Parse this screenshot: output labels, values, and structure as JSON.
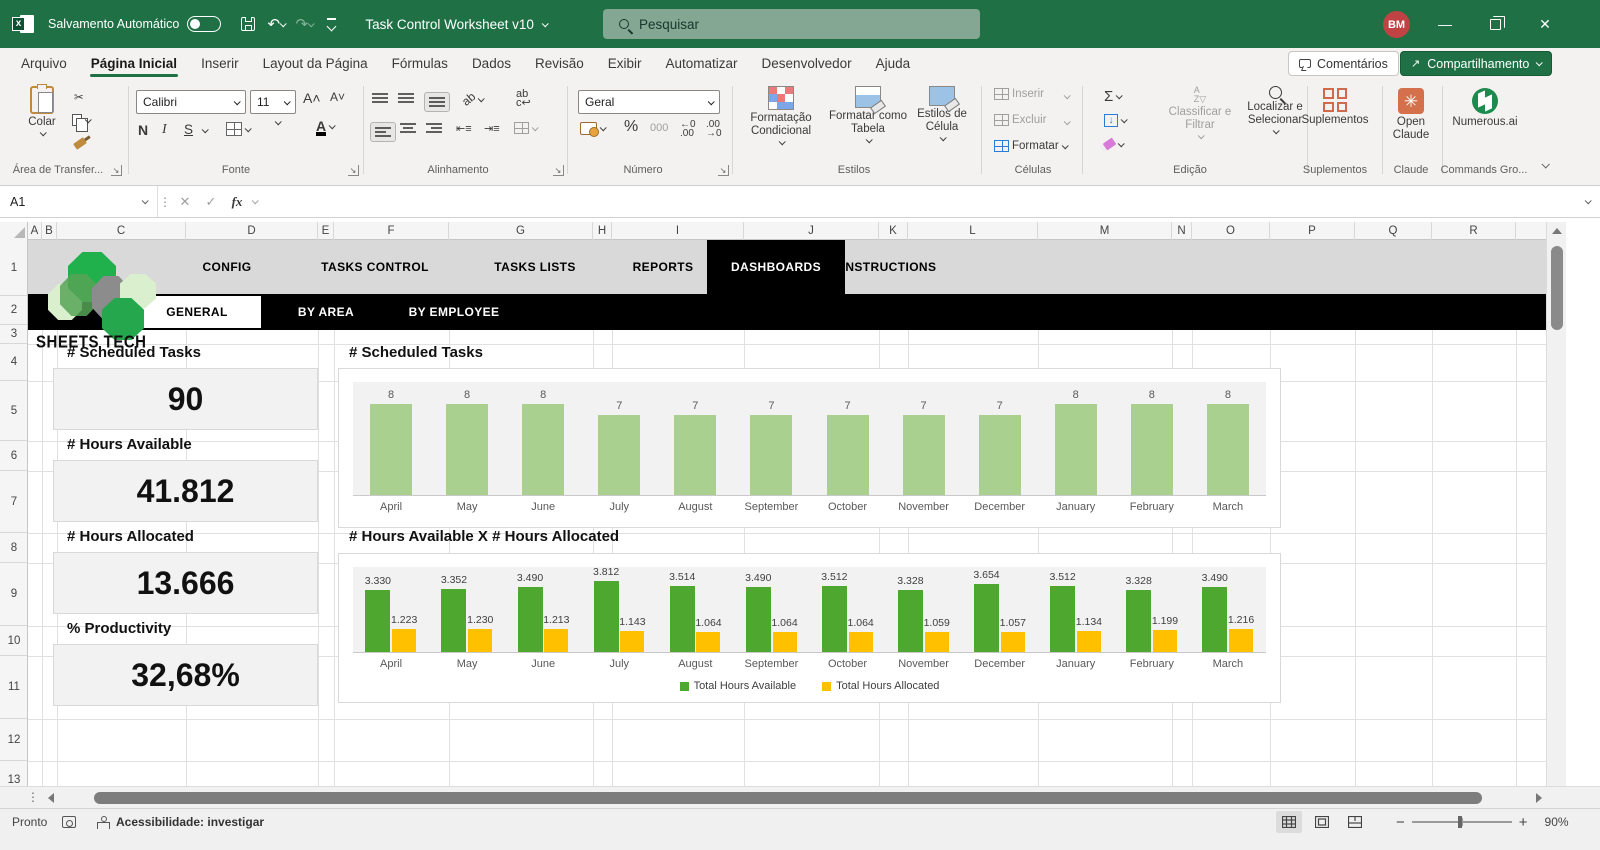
{
  "titlebar": {
    "autosave_label": "Salvamento Automático",
    "autosave_on": false,
    "doc_title": "Task Control Worksheet v10",
    "search_placeholder": "Pesquisar",
    "avatar_initials": "BM"
  },
  "menubar": {
    "tabs": [
      "Arquivo",
      "Página Inicial",
      "Inserir",
      "Layout da Página",
      "Fórmulas",
      "Dados",
      "Revisão",
      "Exibir",
      "Automatizar",
      "Desenvolvedor",
      "Ajuda"
    ],
    "active_tab": "Página Inicial",
    "comments_label": "Comentários",
    "share_label": "Compartilhamento"
  },
  "ribbon": {
    "paste_label": "Colar",
    "clipboard_group": "Área de Transfer...",
    "font_name": "Calibri",
    "font_size": "11",
    "bold": "N",
    "italic": "I",
    "underline": "S",
    "font_group": "Fonte",
    "alignment_group": "Alinhamento",
    "number_format": "Geral",
    "percent": "%",
    "thousands": "000",
    "number_group": "Número",
    "conditional_label": "Formatação Condicional",
    "table_label": "Formatar como Tabela",
    "cellstyles_label": "Estilos de Célula",
    "styles_group": "Estilos",
    "insert_label": "Inserir",
    "delete_label": "Excluir",
    "format_label": "Formatar",
    "cells_group": "Células",
    "sort_label": "Classificar e Filtrar",
    "find_label": "Localizar e Selecionar",
    "editing_group": "Edição",
    "addins_label": "Suplementos",
    "addins_group": "Suplementos",
    "claude_label": "Open Claude",
    "claude_group": "Claude",
    "numerous_label": "Numerous.ai",
    "numerous_group": "Commands Gro..."
  },
  "formula_bar": {
    "name_box": "A1",
    "fx": "fx"
  },
  "grid": {
    "columns": [
      "A",
      "B",
      "C",
      "D",
      "E",
      "F",
      "G",
      "H",
      "I",
      "J",
      "K",
      "L",
      "M",
      "N",
      "O",
      "P",
      "Q",
      "R"
    ],
    "rows": [
      "1",
      "2",
      "3",
      "4",
      "5",
      "6",
      "7",
      "8",
      "9",
      "10",
      "11",
      "12",
      "13"
    ]
  },
  "sheet": {
    "nav_tabs": [
      "CONFIG",
      "TASKS CONTROL",
      "TASKS LISTS",
      "REPORTS",
      "DASHBOARDS",
      "INSTRUCTIONS"
    ],
    "active_nav_tab": "DASHBOARDS",
    "sub_tabs": [
      "GENERAL",
      "BY AREA",
      "BY EMPLOYEE"
    ],
    "active_sub_tab": "GENERAL",
    "logo_text": "SHEETS TECH",
    "kpis": [
      {
        "label": "# Scheduled Tasks",
        "value": "90"
      },
      {
        "label": "# Hours Available",
        "value": "41.812"
      },
      {
        "label": "# Hours Allocated",
        "value": "13.666"
      },
      {
        "label": "% Productivity",
        "value": "32,68%"
      }
    ]
  },
  "chart_data": [
    {
      "type": "bar",
      "title": "# Scheduled Tasks",
      "categories": [
        "April",
        "May",
        "June",
        "July",
        "August",
        "September",
        "October",
        "November",
        "December",
        "January",
        "February",
        "March"
      ],
      "values": [
        8,
        8,
        8,
        7,
        7,
        7,
        7,
        7,
        7,
        8,
        8,
        8
      ],
      "labels": [
        "8",
        "8",
        "8",
        "7",
        "7",
        "7",
        "7",
        "7",
        "7",
        "8",
        "8",
        "8"
      ],
      "ylim": [
        0,
        10
      ],
      "bar_color": "#a9d08e",
      "plot_bg": "#f2f2f2",
      "legend": false
    },
    {
      "type": "bar",
      "title": "# Hours Available  X  # Hours Allocated",
      "categories": [
        "April",
        "May",
        "June",
        "July",
        "August",
        "September",
        "October",
        "November",
        "December",
        "January",
        "February",
        "March"
      ],
      "series": [
        {
          "name": "Total Hours Available",
          "color": "#4ea72e",
          "values": [
            3330,
            3352,
            3490,
            3812,
            3514,
            3490,
            3512,
            3328,
            3654,
            3512,
            3328,
            3490
          ],
          "labels": [
            "3.330",
            "3.352",
            "3.490",
            "3.812",
            "3.514",
            "3.490",
            "3.512",
            "3.328",
            "3.654",
            "3.512",
            "3.328",
            "3.490"
          ]
        },
        {
          "name": "Total Hours Allocated",
          "color": "#ffc000",
          "values": [
            1223,
            1230,
            1213,
            1143,
            1064,
            1064,
            1064,
            1059,
            1057,
            1134,
            1199,
            1216
          ],
          "labels": [
            "1.223",
            "1.230",
            "1.213",
            "1.143",
            "1.064",
            "1.064",
            "1.064",
            "1.059",
            "1.057",
            "1.134",
            "1.199",
            "1.216"
          ]
        }
      ],
      "ylim": [
        0,
        4600
      ],
      "plot_bg": "#f2f2f2",
      "legend": "bottom"
    }
  ],
  "status_bar": {
    "ready": "Pronto",
    "accessibility": "Acessibilidade: investigar",
    "zoom": "90%"
  },
  "colors": {
    "titlebar_green": "#1f7145",
    "nav_gray": "#d9d9d9",
    "nav_black": "#000000",
    "bar_light_green": "#a9d08e",
    "bar_green": "#4ea72e",
    "bar_yellow": "#ffc000",
    "avatar_red": "#bf4342"
  }
}
